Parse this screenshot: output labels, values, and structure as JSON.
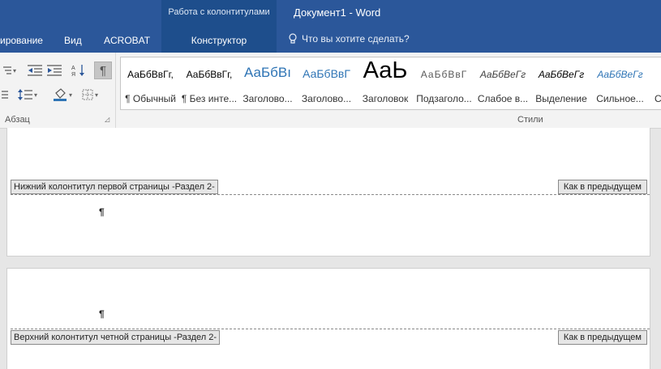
{
  "titlebar": {
    "contextual_group": "Работа с колонтитулами",
    "document_title": "Документ1 - Word",
    "tabs": [
      "ирование",
      "Вид",
      "ACROBAT",
      "Конструктор"
    ],
    "tell_me": "Что вы хотите сделать?"
  },
  "ribbon": {
    "paragraph_group_label": "Абзац",
    "pilcrow_glyph": "¶",
    "styles_group_label": "Стили",
    "styles": [
      {
        "sample": "АаБбВвГг,",
        "name": "¶ Обычный"
      },
      {
        "sample": "АаБбВвГг,",
        "name": "¶ Без инте..."
      },
      {
        "sample": "АаБбВı",
        "name": "Заголово..."
      },
      {
        "sample": "АаБбВвГ",
        "name": "Заголово..."
      },
      {
        "sample": "АаЬ",
        "name": "Заголовок"
      },
      {
        "sample": "АаБбВвГ",
        "name": "Подзаголо..."
      },
      {
        "sample": "АаБбВеГг",
        "name": "Слабое в..."
      },
      {
        "sample": "АаБбВеГг",
        "name": "Выделение"
      },
      {
        "sample": "АаБбВеГг",
        "name": "Сильное..."
      },
      {
        "sample": "",
        "name": "С"
      }
    ]
  },
  "document": {
    "footer_tag": "Нижний колонтитул первой страницы -Раздел 2-",
    "header_tag": "Верхний колонтитул четной страницы -Раздел 2-",
    "same_as_previous": "Как в предыдущем",
    "paragraph_mark": "¶"
  },
  "colors": {
    "title_bar": "#2b579a",
    "contextual_tab": "#1e4e8c",
    "accent_heading": "#2e74b5"
  }
}
